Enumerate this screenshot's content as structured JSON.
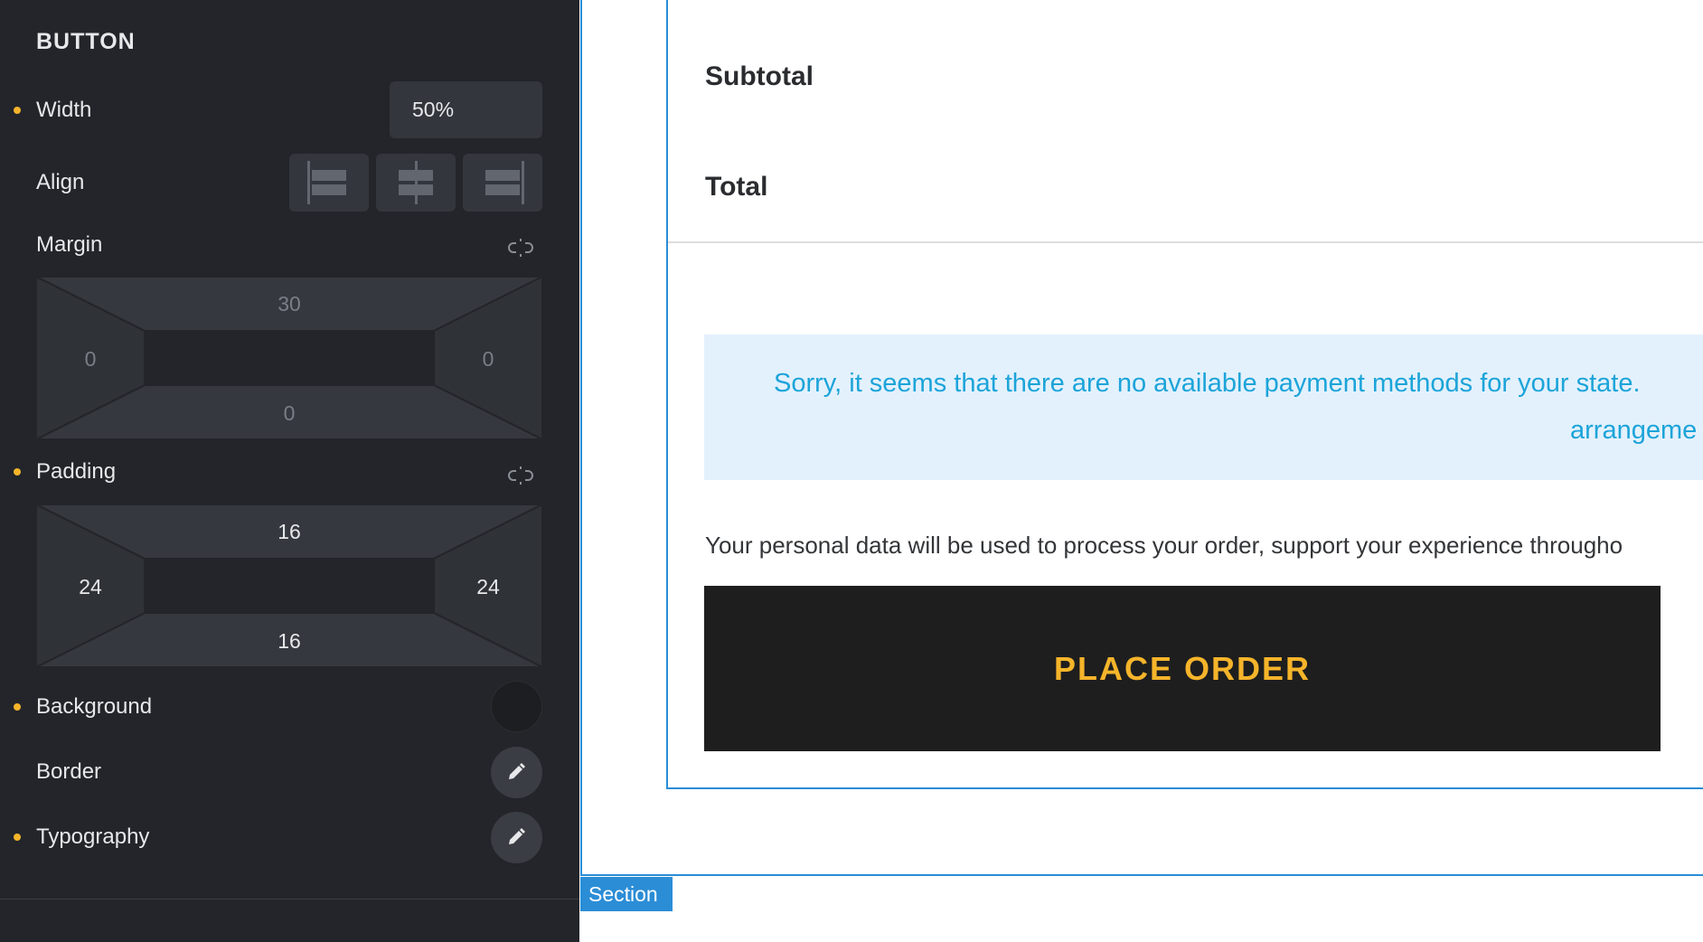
{
  "panel": {
    "title": "BUTTON",
    "width": {
      "label": "Width",
      "value": "50%"
    },
    "align": {
      "label": "Align",
      "options": [
        "left",
        "center",
        "right"
      ]
    },
    "margin": {
      "label": "Margin",
      "top": "30",
      "right": "0",
      "bottom": "0",
      "left": "0"
    },
    "padding": {
      "label": "Padding",
      "top": "16",
      "right": "24",
      "bottom": "16",
      "left": "24"
    },
    "background": {
      "label": "Background",
      "color": "#1d1e21"
    },
    "border": {
      "label": "Border"
    },
    "typography": {
      "label": "Typography"
    },
    "accent_color": "#f5b42a"
  },
  "canvas": {
    "subtotal_label": "Subtotal",
    "total_label": "Total",
    "notice_line1": "Sorry, it seems that there are no available payment methods for your state.",
    "notice_line2": "arrangeme",
    "privacy_text": "Your personal data will be used to process your order, support your experience througho",
    "place_order_label": "PLACE ORDER",
    "section_tag": "Section",
    "outline_color": "#2b8dd6"
  }
}
